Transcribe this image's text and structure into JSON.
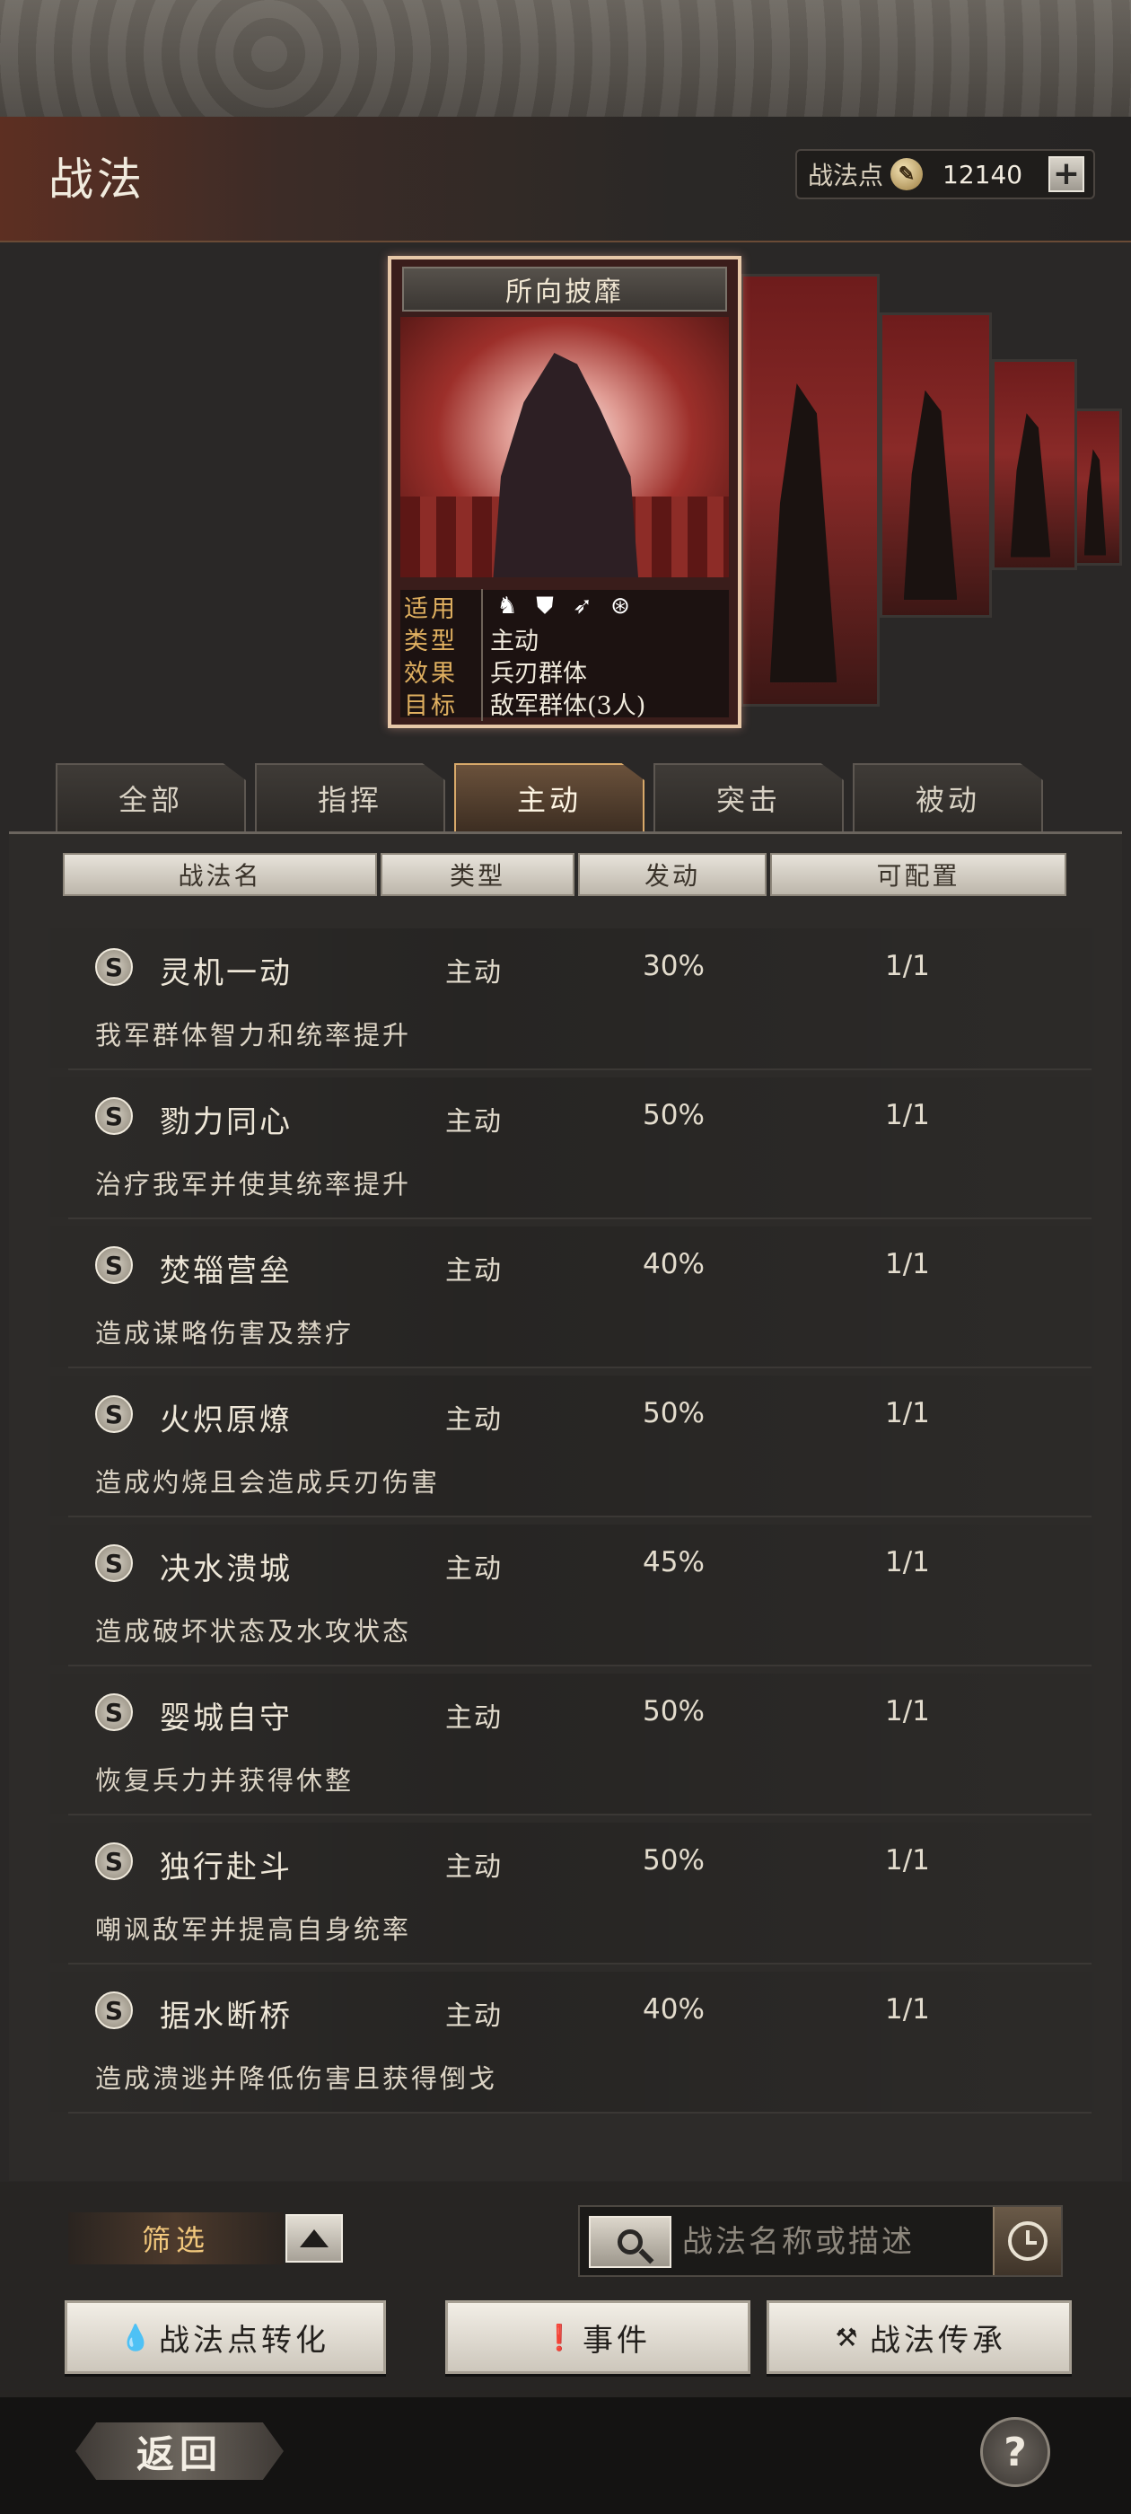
{
  "header": {
    "title": "战法",
    "points_label": "战法点",
    "points_value": "12140",
    "plus_label": "+"
  },
  "card": {
    "title": "所向披靡",
    "info": [
      {
        "key": "适用",
        "value": ""
      },
      {
        "key": "类型",
        "value": "主动"
      },
      {
        "key": "效果",
        "value": "兵刃群体"
      },
      {
        "key": "目标",
        "value": "敌军群体(3人)"
      }
    ],
    "applicable_icons": [
      "cavalry-icon",
      "shield-icon",
      "bow-icon",
      "wheel-icon"
    ]
  },
  "tabs": [
    {
      "label": "全部",
      "active": false
    },
    {
      "label": "指挥",
      "active": false
    },
    {
      "label": "主动",
      "active": true
    },
    {
      "label": "突击",
      "active": false
    },
    {
      "label": "被动",
      "active": false
    }
  ],
  "table": {
    "headers": [
      "战法名",
      "类型",
      "发动",
      "可配置"
    ],
    "rows": [
      {
        "badge": "S",
        "name": "灵机一动",
        "type": "主动",
        "rate": "30%",
        "config": "1/1",
        "desc": "我军群体智力和统率提升"
      },
      {
        "badge": "S",
        "name": "勠力同心",
        "type": "主动",
        "rate": "50%",
        "config": "1/1",
        "desc": "治疗我军并使其统率提升"
      },
      {
        "badge": "S",
        "name": "焚辎营垒",
        "type": "主动",
        "rate": "40%",
        "config": "1/1",
        "desc": "造成谋略伤害及禁疗"
      },
      {
        "badge": "S",
        "name": "火炽原燎",
        "type": "主动",
        "rate": "50%",
        "config": "1/1",
        "desc": "造成灼烧且会造成兵刃伤害"
      },
      {
        "badge": "S",
        "name": "决水溃城",
        "type": "主动",
        "rate": "45%",
        "config": "1/1",
        "desc": "造成破坏状态及水攻状态"
      },
      {
        "badge": "S",
        "name": "婴城自守",
        "type": "主动",
        "rate": "50%",
        "config": "1/1",
        "desc": "恢复兵力并获得休整"
      },
      {
        "badge": "S",
        "name": "独行赴斗",
        "type": "主动",
        "rate": "50%",
        "config": "1/1",
        "desc": "嘲讽敌军并提高自身统率"
      },
      {
        "badge": "S",
        "name": "据水断桥",
        "type": "主动",
        "rate": "40%",
        "config": "1/1",
        "desc": "造成溃逃并降低伤害且获得倒戈"
      }
    ]
  },
  "bottom": {
    "filter_label": "筛选",
    "search_placeholder": "战法名称或描述",
    "buttons": [
      {
        "label": "战法点转化",
        "icon": "drop-icon"
      },
      {
        "label": "事件",
        "icon": "alert-icon"
      },
      {
        "label": "战法传承",
        "icon": "hammer-icon"
      }
    ],
    "back_label": "返回",
    "help_label": "?"
  },
  "colors": {
    "accent_gold": "#e0b060",
    "active_tab_border": "#d8a96a",
    "card_border": "#e7c8a8"
  }
}
